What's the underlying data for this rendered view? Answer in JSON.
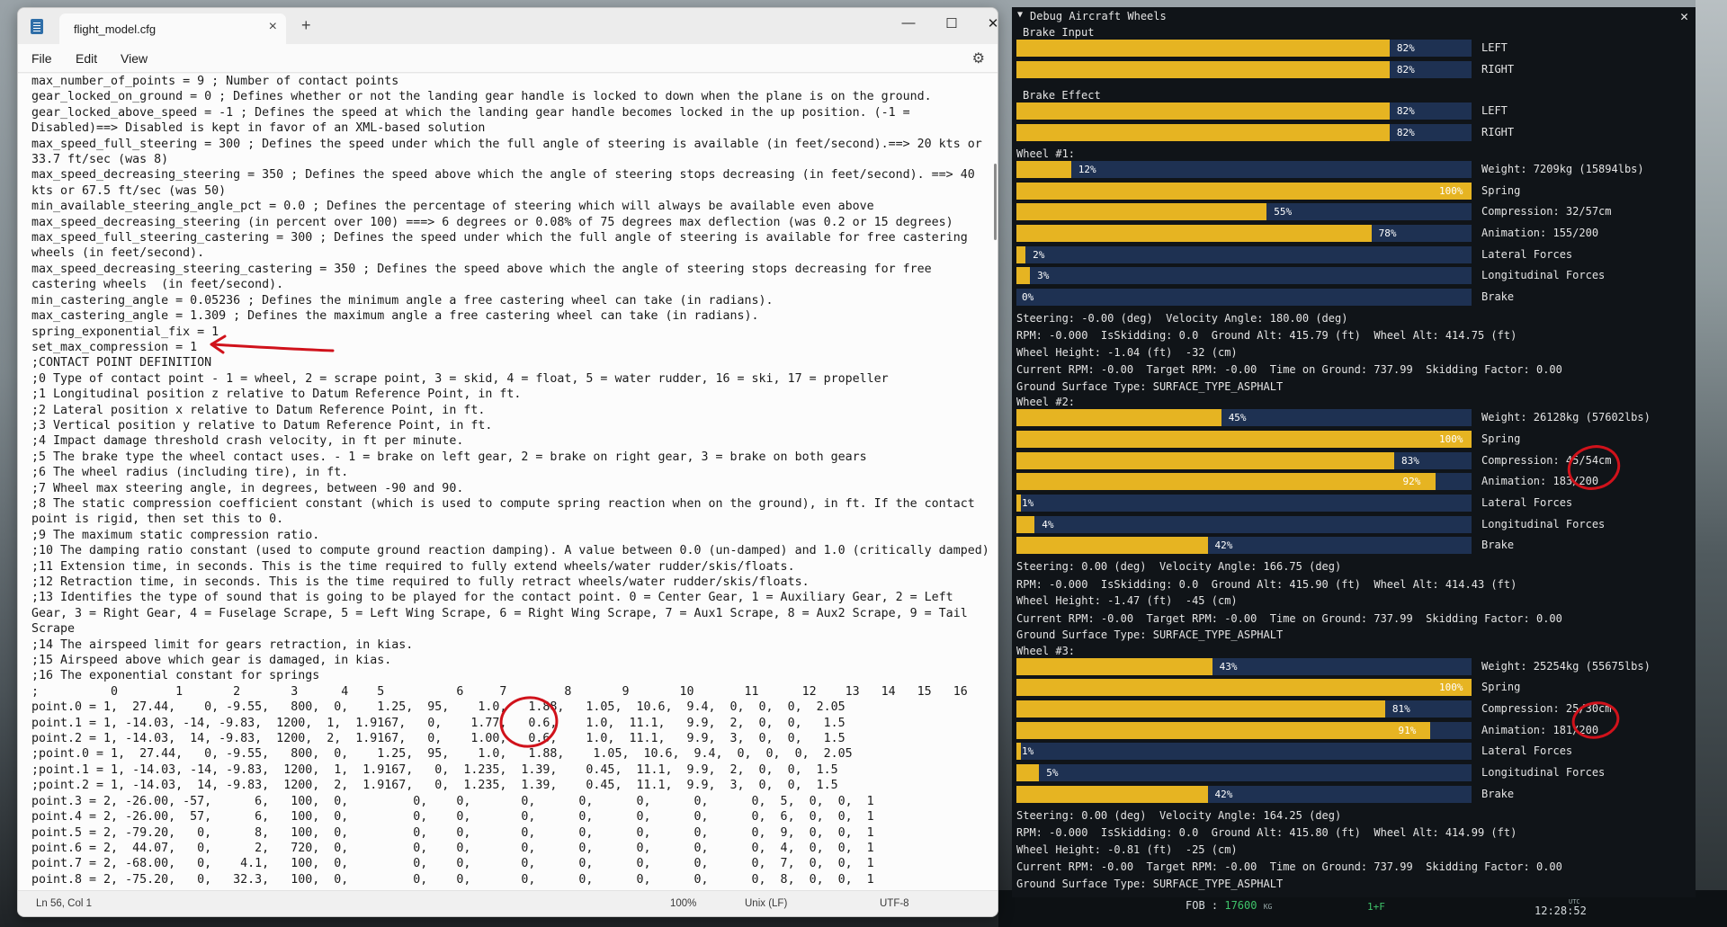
{
  "notepad": {
    "tab_title": "flight_model.cfg",
    "menu": [
      "File",
      "Edit",
      "View"
    ],
    "lines": [
      "max_number_of_points = 9 ; Number of contact points",
      "gear_locked_on_ground = 0 ; Defines whether or not the landing gear handle is locked to down when the plane is on the ground.",
      "gear_locked_above_speed = -1 ; Defines the speed at which the landing gear handle becomes locked in the up position. (-1 =",
      "Disabled)==> Disabled is kept in favor of an XML-based solution",
      "max_speed_full_steering = 300 ; Defines the speed under which the full angle of steering is available (in feet/second).==> 20 kts or",
      "33.7 ft/sec (was 8)",
      "max_speed_decreasing_steering = 350 ; Defines the speed above which the angle of steering stops decreasing (in feet/second). ==> 40",
      "kts or 67.5 ft/sec (was 50)",
      "min_available_steering_angle_pct = 0.0 ; Defines the percentage of steering which will always be available even above",
      "max_speed_decreasing_steering (in percent over 100) ===> 6 degrees or 0.08% of 75 degrees max deflection (was 0.2 or 15 degrees)",
      "max_speed_full_steering_castering = 300 ; Defines the speed under which the full angle of steering is available for free castering",
      "wheels (in feet/second).",
      "max_speed_decreasing_steering_castering = 350 ; Defines the speed above which the angle of steering stops decreasing for free",
      "castering wheels  (in feet/second).",
      "min_castering_angle = 0.05236 ; Defines the minimum angle a free castering wheel can take (in radians).",
      "max_castering_angle = 1.309 ; Defines the maximum angle a free castering wheel can take (in radians).",
      "spring_exponential_fix = 1",
      "set_max_compression = 1",
      ";CONTACT POINT DEFINITION",
      ";0 Type of contact point - 1 = wheel, 2 = scrape point, 3 = skid, 4 = float, 5 = water rudder, 16 = ski, 17 = propeller",
      ";1 Longitudinal position z relative to Datum Reference Point, in ft.",
      ";2 Lateral position x relative to Datum Reference Point, in ft.",
      ";3 Vertical position y relative to Datum Reference Point, in ft.",
      ";4 Impact damage threshold crash velocity, in ft per minute.",
      ";5 The brake type the wheel contact uses. - 1 = brake on left gear, 2 = brake on right gear, 3 = brake on both gears",
      ";6 The wheel radius (including tire), in ft.",
      ";7 Wheel max steering angle, in degrees, between -90 and 90.",
      ";8 The static compression coefficient constant (which is used to compute spring reaction when on the ground), in ft. If the contact",
      "point is rigid, then set this to 0.",
      ";9 The maximum static compression ratio.",
      ";10 The damping ratio constant (used to compute ground reaction damping). A value between 0.0 (un-damped) and 1.0 (critically damped)",
      ";11 Extension time, in seconds. This is the time required to fully extend wheels/water rudder/skis/floats.",
      ";12 Retraction time, in seconds. This is the time required to fully retract wheels/water rudder/skis/floats.",
      ";13 Identifies the type of sound that is going to be played for the contact point. 0 = Center Gear, 1 = Auxiliary Gear, 2 = Left",
      "Gear, 3 = Right Gear, 4 = Fuselage Scrape, 5 = Left Wing Scrape, 6 = Right Wing Scrape, 7 = Aux1 Scrape, 8 = Aux2 Scrape, 9 = Tail",
      "Scrape",
      ";14 The airspeed limit for gears retraction, in kias.",
      ";15 Airspeed above which gear is damaged, in kias.",
      ";16 The exponential constant for springs",
      ";          0        1       2       3      4    5          6     7        8       9       10       11      12    13   14   15   16",
      "point.0 = 1,  27.44,    0, -9.55,   800,  0,    1.25,  95,    1.0,   1.88,   1.05,  10.6,  9.4,  0,  0,  0,  2.05",
      "point.1 = 1, -14.03, -14, -9.83,  1200,  1,  1.9167,   0,    1.77,   0.6,    1.0,  11.1,   9.9,  2,  0,  0,   1.5",
      "point.2 = 1, -14.03,  14, -9.83,  1200,  2,  1.9167,   0,    1.00,   0.6,    1.0,  11.1,   9.9,  3,  0,  0,   1.5",
      ";point.0 = 1,  27.44,   0, -9.55,   800,  0,    1.25,  95,    1.0,   1.88,    1.05,  10.6,  9.4,  0,  0,  0,  2.05",
      ";point.1 = 1, -14.03, -14, -9.83,  1200,  1,  1.9167,   0,  1.235,  1.39,    0.45,  11.1,  9.9,  2,  0,  0,  1.5",
      ";point.2 = 1, -14.03,  14, -9.83,  1200,  2,  1.9167,   0,  1.235,  1.39,    0.45,  11.1,  9.9,  3,  0,  0,  1.5",
      "point.3 = 2, -26.00, -57,      6,   100,  0,         0,    0,       0,      0,      0,      0,      0,  5,  0,  0,  1",
      "point.4 = 2, -26.00,  57,      6,   100,  0,         0,    0,       0,      0,      0,      0,      0,  6,  0,  0,  1",
      "point.5 = 2, -79.20,   0,      8,   100,  0,         0,    0,       0,      0,      0,      0,      0,  9,  0,  0,  1",
      "point.6 = 2,  44.07,   0,      2,   720,  0,         0,    0,       0,      0,      0,      0,      0,  4,  0,  0,  1",
      "point.7 = 2, -68.00,   0,    4.1,   100,  0,         0,    0,       0,      0,      0,      0,      0,  7,  0,  0,  1",
      "point.8 = 2, -75.20,   0,   32.3,   100,  0,         0,    0,       0,      0,      0,      0,      0,  8,  0,  0,  1"
    ],
    "status": {
      "position": "Ln 56, Col 1",
      "zoom": "100%",
      "line_ending": "Unix (LF)",
      "encoding": "UTF-8"
    }
  },
  "debug": {
    "title": "Debug Aircraft Wheels",
    "brake_input": {
      "label": "Brake Input",
      "rows": [
        {
          "pct": 82,
          "text": "82%",
          "label": "LEFT"
        },
        {
          "pct": 82,
          "text": "82%",
          "label": "RIGHT"
        }
      ]
    },
    "brake_effect": {
      "label": "Brake Effect",
      "rows": [
        {
          "pct": 82,
          "text": "82%",
          "label": "LEFT"
        },
        {
          "pct": 82,
          "text": "82%",
          "label": "RIGHT"
        }
      ]
    },
    "wheels": [
      {
        "label": "Wheel #1:",
        "rows": [
          {
            "pct": 12,
            "text": "12%",
            "label": "Weight: 7209kg (15894lbs)"
          },
          {
            "pct": 100,
            "text": "100%",
            "label": "Spring"
          },
          {
            "pct": 55,
            "text": "55%",
            "label": "Compression: 32/57cm"
          },
          {
            "pct": 78,
            "text": "78%",
            "label": "Animation: 155/200"
          },
          {
            "pct": 2,
            "text": "2%",
            "label": "Lateral Forces"
          },
          {
            "pct": 3,
            "text": "3%",
            "label": "Longitudinal Forces"
          },
          {
            "pct": 0,
            "text": "0%",
            "label": "Brake"
          }
        ],
        "info": [
          "Steering: -0.00 (deg)  Velocity Angle: 180.00 (deg)",
          "RPM: -0.000  IsSkidding: 0.0  Ground Alt: 415.79 (ft)  Wheel Alt: 414.75 (ft)",
          "Wheel Height: -1.04 (ft)  -32 (cm)",
          "Current RPM: -0.00  Target RPM: -0.00  Time on Ground: 737.99  Skidding Factor: 0.00",
          "Ground Surface Type: SURFACE_TYPE_ASPHALT"
        ]
      },
      {
        "label": "Wheel #2:",
        "rows": [
          {
            "pct": 45,
            "text": "45%",
            "label": "Weight: 26128kg (57602lbs)"
          },
          {
            "pct": 100,
            "text": "100%",
            "label": "Spring"
          },
          {
            "pct": 83,
            "text": "83%",
            "label": "Compression: 45/54cm"
          },
          {
            "pct": 92,
            "text": "92%",
            "label": "Animation: 183/200"
          },
          {
            "pct": 1,
            "text": "1%",
            "label": "Lateral Forces"
          },
          {
            "pct": 4,
            "text": "4%",
            "label": "Longitudinal Forces"
          },
          {
            "pct": 42,
            "text": "42%",
            "label": "Brake"
          }
        ],
        "info": [
          "Steering: 0.00 (deg)  Velocity Angle: 166.75 (deg)",
          "RPM: -0.000  IsSkidding: 0.0  Ground Alt: 415.90 (ft)  Wheel Alt: 414.43 (ft)",
          "Wheel Height: -1.47 (ft)  -45 (cm)",
          "Current RPM: -0.00  Target RPM: -0.00  Time on Ground: 737.99  Skidding Factor: 0.00",
          "Ground Surface Type: SURFACE_TYPE_ASPHALT"
        ]
      },
      {
        "label": "Wheel #3:",
        "rows": [
          {
            "pct": 43,
            "text": "43%",
            "label": "Weight: 25254kg (55675lbs)"
          },
          {
            "pct": 100,
            "text": "100%",
            "label": "Spring"
          },
          {
            "pct": 81,
            "text": "81%",
            "label": "Compression: 25/30cm"
          },
          {
            "pct": 91,
            "text": "91%",
            "label": "Animation: 181/200"
          },
          {
            "pct": 1,
            "text": "1%",
            "label": "Lateral Forces"
          },
          {
            "pct": 5,
            "text": "5%",
            "label": "Longitudinal Forces"
          },
          {
            "pct": 42,
            "text": "42%",
            "label": "Brake"
          }
        ],
        "info": [
          "Steering: 0.00 (deg)  Velocity Angle: 164.25 (deg)",
          "RPM: -0.000  IsSkidding: 0.0  Ground Alt: 415.80 (ft)  Wheel Alt: 414.99 (ft)",
          "Wheel Height: -0.81 (ft)  -25 (cm)",
          "Current RPM: -0.00  Target RPM: -0.00  Time on Ground: 737.99  Skidding Factor: 0.00",
          "Ground Surface Type: SURFACE_TYPE_ASPHALT"
        ]
      }
    ]
  },
  "sim_hud": {
    "fob_label": "FOB :",
    "fob_value": "17600",
    "fob_unit": "KG",
    "flaps": "1+F",
    "utc_label": "UTC",
    "utc_time": "12:28:52"
  },
  "colors": {
    "bar_fill": "#e6b422",
    "bar_track": "#1e3152",
    "annotation": "#d0121b"
  }
}
